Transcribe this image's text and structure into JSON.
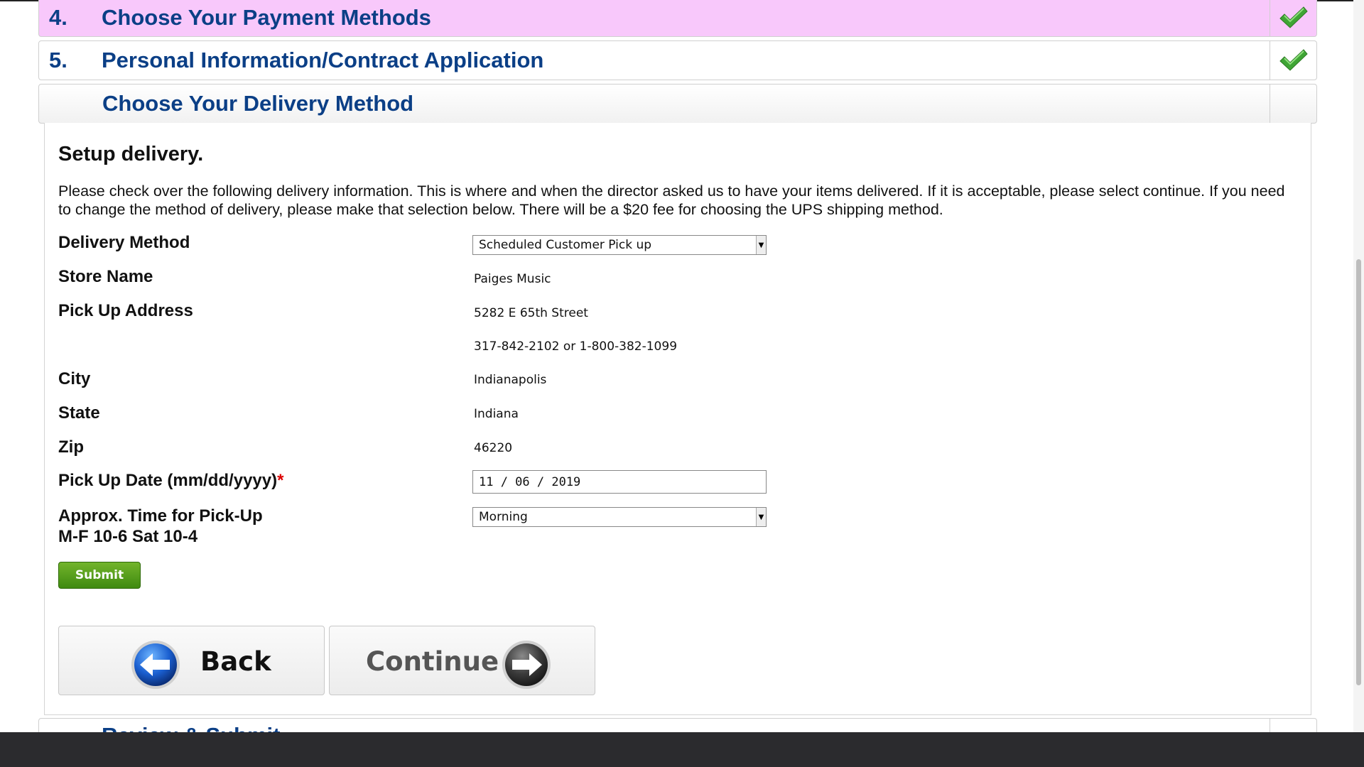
{
  "steps": {
    "payment": {
      "number": "4.",
      "title": "Choose Your Payment Methods",
      "completed": true,
      "highlight_color": "#f8c8fb"
    },
    "personal": {
      "number": "5.",
      "title": "Personal Information/Contract Application",
      "completed": true
    },
    "delivery": {
      "title": "Choose Your Delivery Method",
      "active": true
    },
    "review": {
      "title": "Review & Submit"
    }
  },
  "delivery_panel": {
    "heading": "Setup delivery.",
    "intro": "Please check over the following delivery information. This is where and when the director asked us to have your items delivered. If it is acceptable, please select continue. If you need to change the method of delivery, please make that selection below. There will be a $20 fee for choosing the UPS shipping method.",
    "fields": {
      "delivery_method": {
        "label": "Delivery Method",
        "value": "Scheduled Customer Pick up"
      },
      "store_name": {
        "label": "Store Name",
        "value": "Paiges Music"
      },
      "pickup_address": {
        "label": "Pick Up Address",
        "value": "5282 E 65th Street",
        "phone": "317-842-2102 or 1-800-382-1099"
      },
      "city": {
        "label": "City",
        "value": "Indianapolis"
      },
      "state": {
        "label": "State",
        "value": "Indiana"
      },
      "zip": {
        "label": "Zip",
        "value": "46220"
      },
      "pickup_date": {
        "label": "Pick Up Date (mm/dd/yyyy)",
        "required_mark": "*",
        "value": "11 / 06 / 2019"
      },
      "pickup_time": {
        "label_line1": "Approx. Time for Pick-Up",
        "label_line2": "M-F 10-6 Sat 10-4",
        "value": "Morning"
      }
    },
    "submit_label": "Submit",
    "back_label": "Back",
    "continue_label": "Continue"
  },
  "colors": {
    "heading_blue": "#0b3f86",
    "check_green": "#3fa535",
    "submit_green": "#4f9a1a",
    "required_red": "#dd0000"
  }
}
